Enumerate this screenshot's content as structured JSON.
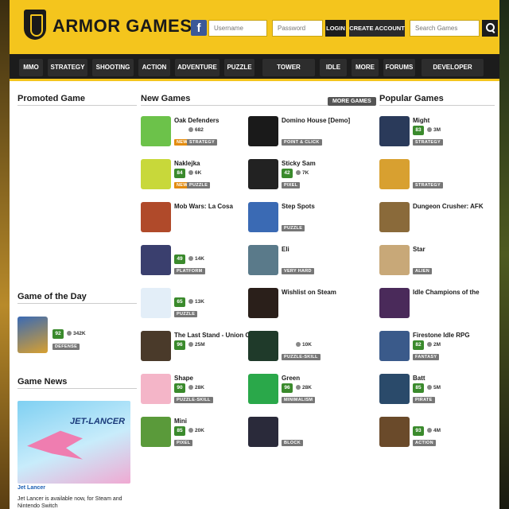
{
  "header": {
    "logo_text": "ARMOR GAMES",
    "facebook_icon": "f",
    "username_placeholder": "Username",
    "password_placeholder": "Password",
    "login_label": "LOGIN",
    "create_account_label": "CREATE ACCOUNT",
    "search_placeholder": "Search Games"
  },
  "nav": {
    "items": [
      "MMO",
      "STRATEGY",
      "SHOOTING",
      "ACTION",
      "ADVENTURE",
      "PUZZLE",
      "TOWER DEFENSE",
      "IDLE",
      "MORE",
      "FORUMS",
      "DEVELOPER PORTAL"
    ]
  },
  "sections": {
    "promoted": "Promoted Game",
    "new_games": "New Games",
    "more_games": "MORE GAMES",
    "popular_games": "Popular Games",
    "game_of_the_day": "Game of the Day",
    "game_news": "Game News"
  },
  "game_of_day": {
    "rating": "92",
    "plays": "342K",
    "tag": "DEFENSE"
  },
  "news": {
    "promo_title": "JET-LANCER",
    "link": "Jet Lancer",
    "text": "Jet Lancer is available now, for Steam and Nintendo Switch"
  },
  "new_games": [
    {
      "title": "Oak Defenders",
      "rating": "",
      "plays": "682",
      "tag": "STRATEGY",
      "new": true,
      "color": "#6cc24a"
    },
    {
      "title": "Naklejka",
      "rating": "84",
      "plays": "6K",
      "tag": "PUZZLE",
      "new": true,
      "color": "#c8d83a"
    },
    {
      "title": "Mob Wars: La Cosa",
      "rating": "",
      "plays": "",
      "tag": "",
      "new": false,
      "color": "#b04a2a"
    },
    {
      "title": "",
      "rating": "49",
      "plays": "14K",
      "tag": "PLATFORM",
      "new": false,
      "color": "#3a3f6e"
    },
    {
      "title": "",
      "rating": "65",
      "plays": "13K",
      "tag": "PUZZLE",
      "new": false,
      "color": "#e3eef8"
    },
    {
      "title": "The Last Stand - Union City",
      "rating": "96",
      "plays": "25M",
      "tag": "",
      "new": false,
      "color": "#4a3a2a"
    },
    {
      "title": "Shape",
      "rating": "90",
      "plays": "28K",
      "tag": "PUZZLE-SKILL",
      "new": false,
      "color": "#f4b5c8"
    },
    {
      "title": "Mini",
      "rating": "85",
      "plays": "20K",
      "tag": "PIXEL",
      "new": false,
      "color": "#5a9a3a"
    }
  ],
  "mid_games": [
    {
      "title": "Domino House [Demo]",
      "rating": "",
      "plays": "",
      "tag": "POINT & CLICK",
      "new": false,
      "color": "#1a1a1a"
    },
    {
      "title": "Sticky Sam",
      "rating": "42",
      "plays": "7K",
      "tag": "PIXEL",
      "new": false,
      "color": "#222222"
    },
    {
      "title": "Step Spots",
      "rating": "",
      "plays": "",
      "tag": "PUZZLE",
      "new": false,
      "color": "#3a6ab4"
    },
    {
      "title": "Eli",
      "rating": "",
      "plays": "",
      "tag": "VERY HARD",
      "new": false,
      "color": "#5a7a8a"
    },
    {
      "title": "Wishlist on Steam",
      "rating": "",
      "plays": "",
      "tag": "",
      "new": false,
      "color": "#2a1f1a"
    },
    {
      "title": "",
      "rating": "",
      "plays": "10K",
      "tag": "PUZZLE-SKILL",
      "new": false,
      "color": "#1f3a2a"
    },
    {
      "title": "Green",
      "rating": "96",
      "plays": "28K",
      "tag": "MINIMALISM",
      "new": false,
      "color": "#2aa84a"
    },
    {
      "title": "",
      "rating": "",
      "plays": "",
      "tag": "BLOCK",
      "new": false,
      "color": "#2a2a3a"
    }
  ],
  "popular_games": [
    {
      "title": "Might",
      "rating": "83",
      "plays": "3M",
      "tag": "STRATEGY",
      "color": "#2a3a5a"
    },
    {
      "title": "",
      "rating": "",
      "plays": "",
      "tag": "STRATEGY",
      "color": "#d8a030"
    },
    {
      "title": "Dungeon Crusher: AFK",
      "rating": "",
      "plays": "",
      "tag": "",
      "color": "#8a6a3a"
    },
    {
      "title": "Star",
      "rating": "",
      "plays": "",
      "tag": "ALIEN",
      "color": "#c8a878"
    },
    {
      "title": "Idle Champions of the",
      "rating": "",
      "plays": "",
      "tag": "",
      "color": "#4a2a5a"
    },
    {
      "title": "Firestone Idle RPG",
      "rating": "82",
      "plays": "2M",
      "tag": "FANTASY",
      "color": "#3a5a8a"
    },
    {
      "title": "Batt",
      "rating": "85",
      "plays": "5M",
      "tag": "PIRATE",
      "color": "#2a4a6a"
    },
    {
      "title": "",
      "rating": "93",
      "plays": "4M",
      "tag": "ACTION",
      "color": "#6a4a2a"
    }
  ],
  "colors": {
    "brand": "#f4c51d",
    "nav": "#1c1c1c",
    "rating": "#3a8a2c",
    "new_tag": "#e38c10"
  }
}
